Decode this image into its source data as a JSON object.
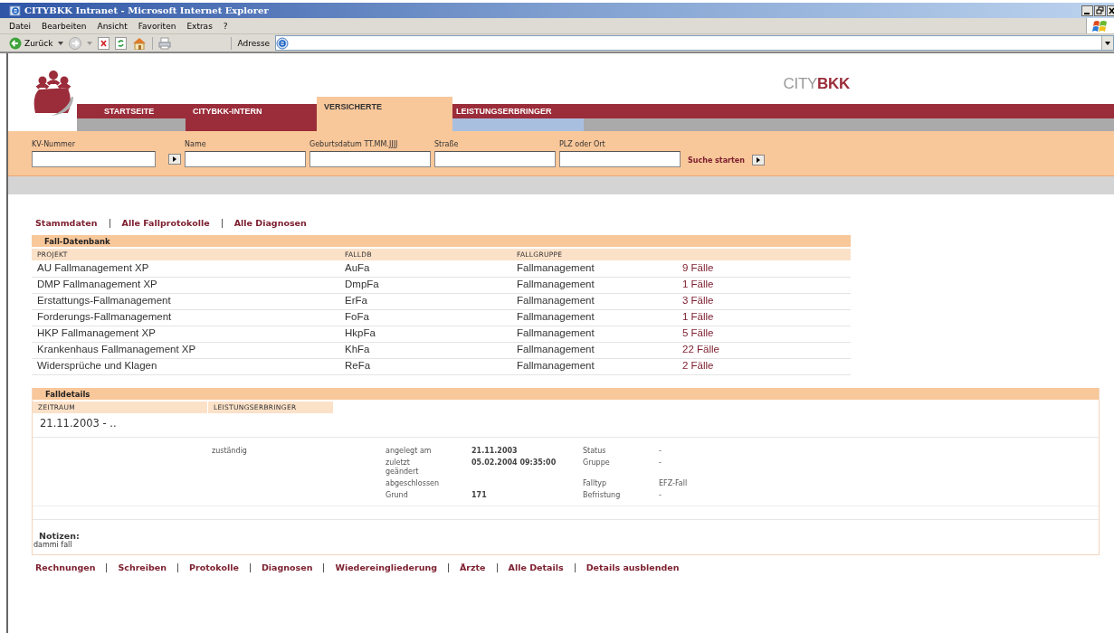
{
  "window": {
    "title": "CITYBKK Intranet - Microsoft Internet Explorer"
  },
  "menu": [
    "Datei",
    "Bearbeiten",
    "Ansicht",
    "Favoriten",
    "Extras",
    "?"
  ],
  "toolbar": {
    "back": "Zurück",
    "address_label": "Adresse"
  },
  "brand": {
    "part1": "CITY",
    "part2": "BKK"
  },
  "nav": [
    {
      "label": "STARTSEITE",
      "selected": false
    },
    {
      "label": "CITYBKK-INTERN",
      "selected": false
    },
    {
      "label": "VERSICHERTE",
      "selected": true
    },
    {
      "label": "LEISTUNGSERBRINGER",
      "selected": false
    }
  ],
  "search": {
    "fields": [
      {
        "label": "KV-Nummer",
        "kind": "button"
      },
      {
        "label": "Name",
        "kind": "plain"
      },
      {
        "label": "Geburtsdatum TT.MM.JJJJ",
        "kind": "plain"
      },
      {
        "label": "Straße",
        "kind": "plain"
      },
      {
        "label": "PLZ oder Ort",
        "kind": "plain"
      }
    ],
    "submit": "Suche starten"
  },
  "top_links": [
    "Stammdaten",
    "Alle Fallprotokolle",
    "Alle Diagnosen"
  ],
  "fall_datenbank": {
    "title": "Fall-Datenbank",
    "columns": [
      "PROJEKT",
      "FALLDB",
      "FALLGRUPPE"
    ],
    "rows": [
      [
        "AU Fallmanagement XP",
        "AuFa",
        "Fallmanagement",
        "9 Fälle"
      ],
      [
        "DMP Fallmanagement XP",
        "DmpFa",
        "Fallmanagement",
        "1 Fälle"
      ],
      [
        "Erstattungs-Fallmanagement",
        "ErFa",
        "Fallmanagement",
        "3 Fälle"
      ],
      [
        "Forderungs-Fallmanagement",
        "FoFa",
        "Fallmanagement",
        "1 Fälle"
      ],
      [
        "HKP Fallmanagement XP",
        "HkpFa",
        "Fallmanagement",
        "5 Fälle"
      ],
      [
        "Krankenhaus Fallmanagement XP",
        "KhFa",
        "Fallmanagement",
        "22 Fälle"
      ],
      [
        "Widersprüche und Klagen",
        "ReFa",
        "Fallmanagement",
        "2 Fälle"
      ]
    ]
  },
  "falldetails": {
    "title": "Falldetails",
    "columns": [
      "ZEITRAUM",
      "LEISTUNGSERBRINGER"
    ],
    "period": "21.11.2003 - ..",
    "role": "zuständig",
    "details": [
      {
        "label": "angelegt am",
        "value": "21.11.2003",
        "label2": "Status",
        "value2": "-"
      },
      {
        "label": "zuletzt geändert",
        "value": "05.02.2004 09:35:00",
        "label2": "Gruppe",
        "value2": "-"
      },
      {
        "label": "abgeschlossen",
        "label2": "Falltyp",
        "value2": "EFZ-Fall"
      },
      {
        "label": "Grund",
        "value": "171",
        "label2": "Befristung",
        "value2": "-"
      }
    ],
    "notes_title": "Notizen:",
    "notes": "dammi fall"
  },
  "bottom_links": [
    "Rechnungen",
    "Schreiben",
    "Protokolle",
    "Diagnosen",
    "Wiedereingliederung",
    "Ärzte",
    "Alle Details",
    "Details ausblenden"
  ]
}
